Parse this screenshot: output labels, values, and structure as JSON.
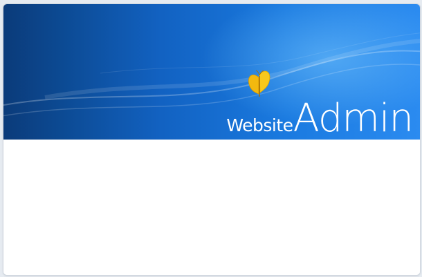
{
  "header": {
    "logo_word_small": "Website",
    "logo_word_large": "Admin",
    "logo_icon": "butterfly-icon"
  },
  "colors": {
    "banner_dark": "#0b3b7a",
    "banner_light": "#2b8bf0",
    "butterfly": "#f5c518",
    "page_background": "#e6ebf1"
  }
}
